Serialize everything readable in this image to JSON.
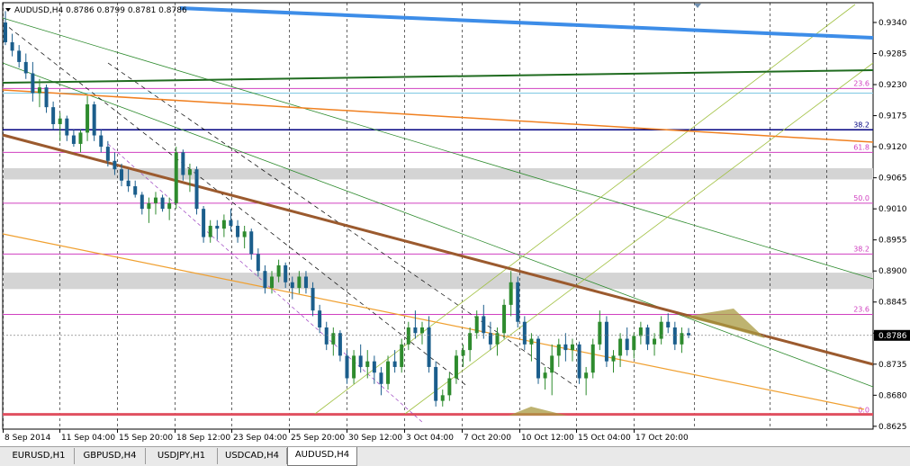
{
  "chart_header": {
    "symbol_timeframe": "AUDUSD,H4",
    "open": "0.8786",
    "high": "0.8799",
    "low": "0.8781",
    "close": "0.8786"
  },
  "current_price": "0.8786",
  "price_axis": {
    "ticks": [
      "0.9340",
      "0.9285",
      "0.9230",
      "0.9175",
      "0.9120",
      "0.9065",
      "0.9010",
      "0.8955",
      "0.8900",
      "0.8845",
      "0.8790",
      "0.8735",
      "0.8680",
      "0.8625"
    ],
    "ylim": [
      0.862,
      0.9375
    ]
  },
  "time_axis": {
    "labels": [
      "8 Sep 2014",
      "11 Sep 04:00",
      "15 Sep 20:00",
      "18 Sep 12:00",
      "23 Sep 04:00",
      "25 Sep 20:00",
      "30 Sep 12:00",
      "3 Oct 04:00",
      "7 Oct 20:00",
      "10 Oct 12:00",
      "15 Oct 04:00",
      "17 Oct 20:00"
    ]
  },
  "fibo_levels": [
    {
      "label": "23.6",
      "price": 0.9223,
      "color": "#d040c0"
    },
    {
      "label": "38.2",
      "price": 0.915,
      "color": "#000080"
    },
    {
      "label": "61.8",
      "price": 0.911,
      "color": "#d040c0"
    },
    {
      "label": "50.0",
      "price": 0.902,
      "color": "#d040c0"
    },
    {
      "label": "38.2",
      "price": 0.893,
      "color": "#d040c0"
    },
    {
      "label": "23.6",
      "price": 0.8823,
      "color": "#d040c0"
    },
    {
      "label": "0.0",
      "price": 0.8645,
      "color": "#d040c0"
    }
  ],
  "candles": [
    [
      0.934,
      0.936,
      0.93,
      0.9305
    ],
    [
      0.9305,
      0.932,
      0.928,
      0.929
    ],
    [
      0.929,
      0.93,
      0.926,
      0.927
    ],
    [
      0.927,
      0.9285,
      0.924,
      0.925
    ],
    [
      0.925,
      0.927,
      0.92,
      0.9215
    ],
    [
      0.9215,
      0.924,
      0.919,
      0.9225
    ],
    [
      0.9225,
      0.923,
      0.918,
      0.919
    ],
    [
      0.919,
      0.92,
      0.915,
      0.916
    ],
    [
      0.916,
      0.918,
      0.913,
      0.917
    ],
    [
      0.917,
      0.9175,
      0.913,
      0.914
    ],
    [
      0.914,
      0.915,
      0.912,
      0.9125
    ],
    [
      0.9125,
      0.915,
      0.911,
      0.9145
    ],
    [
      0.9145,
      0.921,
      0.913,
      0.9195
    ],
    [
      0.9195,
      0.92,
      0.913,
      0.914
    ],
    [
      0.914,
      0.915,
      0.911,
      0.912
    ],
    [
      0.912,
      0.913,
      0.9085,
      0.9095
    ],
    [
      0.9095,
      0.911,
      0.907,
      0.908
    ],
    [
      0.908,
      0.909,
      0.905,
      0.906
    ],
    [
      0.906,
      0.908,
      0.904,
      0.905
    ],
    [
      0.905,
      0.906,
      0.903,
      0.9035
    ],
    [
      0.9035,
      0.904,
      0.9,
      0.901
    ],
    [
      0.901,
      0.903,
      0.8985,
      0.902
    ],
    [
      0.902,
      0.904,
      0.9,
      0.903
    ],
    [
      0.903,
      0.9035,
      0.9005,
      0.901
    ],
    [
      0.901,
      0.903,
      0.899,
      0.902
    ],
    [
      0.902,
      0.912,
      0.901,
      0.911
    ],
    [
      0.911,
      0.9115,
      0.906,
      0.907
    ],
    [
      0.907,
      0.909,
      0.904,
      0.908
    ],
    [
      0.908,
      0.9085,
      0.9,
      0.901
    ],
    [
      0.901,
      0.9015,
      0.895,
      0.896
    ],
    [
      0.896,
      0.899,
      0.895,
      0.898
    ],
    [
      0.898,
      0.899,
      0.8955,
      0.8975
    ],
    [
      0.8975,
      0.9,
      0.896,
      0.899
    ],
    [
      0.899,
      0.901,
      0.897,
      0.898
    ],
    [
      0.898,
      0.899,
      0.895,
      0.896
    ],
    [
      0.896,
      0.898,
      0.894,
      0.897
    ],
    [
      0.897,
      0.8975,
      0.892,
      0.893
    ],
    [
      0.893,
      0.894,
      0.889,
      0.89
    ],
    [
      0.89,
      0.891,
      0.886,
      0.887
    ],
    [
      0.887,
      0.89,
      0.886,
      0.889
    ],
    [
      0.889,
      0.892,
      0.888,
      0.891
    ],
    [
      0.891,
      0.8915,
      0.887,
      0.888
    ],
    [
      0.888,
      0.889,
      0.885,
      0.887
    ],
    [
      0.887,
      0.89,
      0.886,
      0.889
    ],
    [
      0.889,
      0.89,
      0.886,
      0.887
    ],
    [
      0.887,
      0.888,
      0.882,
      0.883
    ],
    [
      0.883,
      0.884,
      0.879,
      0.88
    ],
    [
      0.88,
      0.881,
      0.876,
      0.877
    ],
    [
      0.877,
      0.88,
      0.875,
      0.879
    ],
    [
      0.879,
      0.8795,
      0.874,
      0.875
    ],
    [
      0.875,
      0.876,
      0.87,
      0.871
    ],
    [
      0.871,
      0.876,
      0.87,
      0.875
    ],
    [
      0.875,
      0.877,
      0.872,
      0.873
    ],
    [
      0.873,
      0.876,
      0.871,
      0.874
    ],
    [
      0.874,
      0.875,
      0.87,
      0.872
    ],
    [
      0.872,
      0.873,
      0.868,
      0.87
    ],
    [
      0.87,
      0.875,
      0.869,
      0.874
    ],
    [
      0.874,
      0.876,
      0.872,
      0.873
    ],
    [
      0.873,
      0.878,
      0.872,
      0.877
    ],
    [
      0.877,
      0.881,
      0.876,
      0.88
    ],
    [
      0.88,
      0.883,
      0.878,
      0.879
    ],
    [
      0.879,
      0.881,
      0.877,
      0.88
    ],
    [
      0.88,
      0.882,
      0.872,
      0.873
    ],
    [
      0.873,
      0.874,
      0.866,
      0.867
    ],
    [
      0.867,
      0.869,
      0.866,
      0.868
    ],
    [
      0.868,
      0.872,
      0.867,
      0.871
    ],
    [
      0.871,
      0.876,
      0.87,
      0.875
    ],
    [
      0.875,
      0.877,
      0.873,
      0.876
    ],
    [
      0.876,
      0.88,
      0.874,
      0.879
    ],
    [
      0.879,
      0.883,
      0.878,
      0.882
    ],
    [
      0.882,
      0.884,
      0.878,
      0.879
    ],
    [
      0.879,
      0.881,
      0.876,
      0.877
    ],
    [
      0.877,
      0.88,
      0.875,
      0.879
    ],
    [
      0.879,
      0.885,
      0.878,
      0.884
    ],
    [
      0.884,
      0.89,
      0.882,
      0.888
    ],
    [
      0.888,
      0.889,
      0.88,
      0.881
    ],
    [
      0.881,
      0.882,
      0.876,
      0.877
    ],
    [
      0.877,
      0.879,
      0.874,
      0.878
    ],
    [
      0.878,
      0.8785,
      0.87,
      0.871
    ],
    [
      0.871,
      0.873,
      0.869,
      0.872
    ],
    [
      0.872,
      0.877,
      0.868,
      0.875
    ],
    [
      0.875,
      0.878,
      0.873,
      0.877
    ],
    [
      0.877,
      0.879,
      0.874,
      0.876
    ],
    [
      0.876,
      0.878,
      0.874,
      0.877
    ],
    [
      0.877,
      0.8775,
      0.87,
      0.871
    ],
    [
      0.871,
      0.873,
      0.868,
      0.872
    ],
    [
      0.872,
      0.878,
      0.871,
      0.877
    ],
    [
      0.877,
      0.883,
      0.876,
      0.881
    ],
    [
      0.881,
      0.882,
      0.873,
      0.874
    ],
    [
      0.874,
      0.876,
      0.872,
      0.875
    ],
    [
      0.875,
      0.879,
      0.873,
      0.878
    ],
    [
      0.878,
      0.88,
      0.875,
      0.876
    ],
    [
      0.876,
      0.879,
      0.8745,
      0.8785
    ],
    [
      0.8785,
      0.881,
      0.877,
      0.88
    ],
    [
      0.88,
      0.8805,
      0.876,
      0.877
    ],
    [
      0.877,
      0.879,
      0.875,
      0.878
    ],
    [
      0.878,
      0.882,
      0.877,
      0.881
    ],
    [
      0.881,
      0.8825,
      0.879,
      0.88
    ],
    [
      0.88,
      0.881,
      0.876,
      0.877
    ],
    [
      0.877,
      0.88,
      0.8755,
      0.879
    ],
    [
      0.879,
      0.8799,
      0.8781,
      0.8786
    ]
  ],
  "tabs": [
    {
      "label": "EURUSD,H1"
    },
    {
      "label": "GBPUSD,H4"
    },
    {
      "label": "USDJPY,H1"
    },
    {
      "label": "USDCAD,H4"
    },
    {
      "label": "AUDUSD,H4"
    }
  ],
  "active_tab": 4,
  "colors": {
    "bull": "#2e8b2e",
    "bear": "#1b5e8c",
    "trend_blue": "#3d8de8",
    "trend_green": "#1f6b1f",
    "trend_brown": "#9b5a2e",
    "trend_orange": "#f0a030",
    "support_red": "#e05060",
    "zone_gray": "#d4d4d4"
  }
}
